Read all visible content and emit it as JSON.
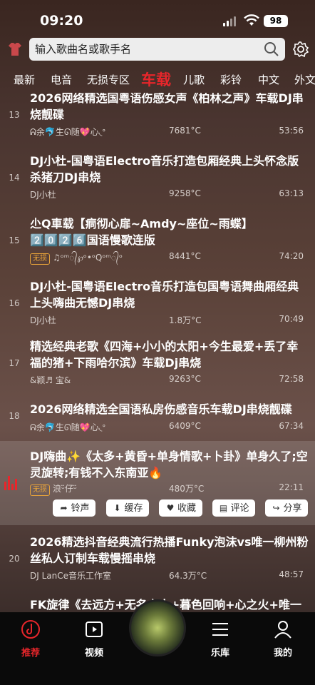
{
  "status": {
    "time": "09:20",
    "battery": "98"
  },
  "search": {
    "placeholder": "输入歌曲名或歌手名"
  },
  "tabs": [
    "最新",
    "电音",
    "无损专区",
    "车载",
    "儿歌",
    "彩铃",
    "中文",
    "外文"
  ],
  "active_tab": "车载",
  "songs": [
    {
      "num": "13",
      "title": "2026网络精选国粤语伤感女声《柏林之声》车载DJ串烧靓碟",
      "artist": "ᕱ余🐬生ᘏ随💖心◟ᐤ",
      "plays": "7681°C",
      "duration": "53:56",
      "lossless": ""
    },
    {
      "num": "14",
      "title": "DJ小杜-国粤语Electro音乐打造包厢经典上头怀念版杀猪刀DJ串烧",
      "artist": "DJ小杜",
      "plays": "9258°C",
      "duration": "63:13",
      "lossless": ""
    },
    {
      "num": "15",
      "title": "尐Q車载【痌彻心扉~Amdy~座位~雨蝶】2️⃣0️⃣2️⃣6️⃣国语慢歌连版",
      "artist": "♫ᵒᵐ᭄℘ᵒ•ᵒQᵒᵐ᭄ᵒ",
      "plays": "8441°C",
      "duration": "74:20",
      "lossless": "无损"
    },
    {
      "num": "16",
      "title": "DJ小杜-国粤语Electro音乐打造包国粤语舞曲厢经典上头嗨曲无憾DJ串烧",
      "artist": "DJ小杜",
      "plays": "1.8万°C",
      "duration": "70:49",
      "lossless": ""
    },
    {
      "num": "17",
      "title": "精选经典老歌《四海+小小的太阳+今生最爱+丢了幸福的猪+下雨哈尔滨》车载Dj串烧",
      "artist": "&颖♬ 宝&",
      "plays": "9263°C",
      "duration": "72:58",
      "lossless": ""
    },
    {
      "num": "18",
      "title": "2026网络精选全国语私房伤感音乐车载DJ串烧靓碟",
      "artist": "ᕱ余🐬生ᘏ随💖心◟ᐤ",
      "plays": "6409°C",
      "duration": "67:34",
      "lossless": ""
    },
    {
      "num": "",
      "title": "DJ嗨曲✨《太多+黄昏+单身情歌+卜卦》单身久了;空灵旋转;有钱不入东南亚🔥",
      "artist": "浪ᵕ̈仔ᵕ̈",
      "plays": "480万°C",
      "duration": "22:11",
      "lossless": "无损"
    },
    {
      "num": "20",
      "title": "2026精选抖音经典流行热播Funky泡沫vs唯一柳州粉丝私人订制车载慢摇串烧",
      "artist": "DJ LanCe音乐工作室",
      "plays": "64.3万°C",
      "duration": "48:57",
      "lossless": ""
    },
    {
      "num": "",
      "title": "FK旋律《去远方+无名之人+暮色回响+心之火+唯一",
      "artist": "",
      "plays": "",
      "duration": "",
      "lossless": ""
    }
  ],
  "actions": [
    "铃声",
    "缓存",
    "收藏",
    "评论",
    "分享"
  ],
  "nav": {
    "items": [
      "推荐",
      "视频",
      "乐库",
      "我的"
    ],
    "active": "推荐"
  }
}
